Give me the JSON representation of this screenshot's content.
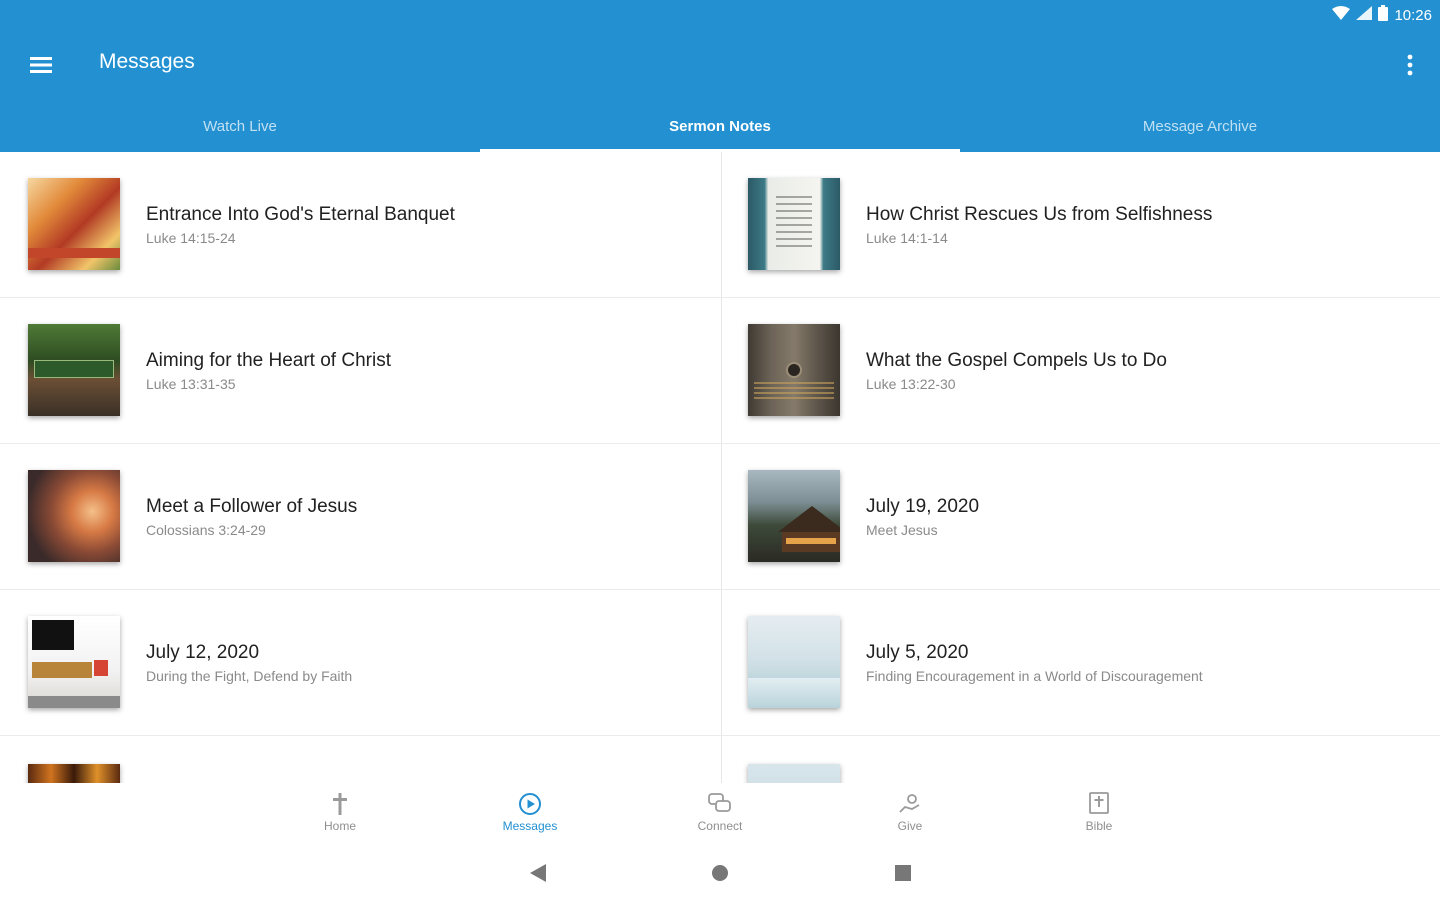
{
  "status_bar": {
    "time": "10:26"
  },
  "app_bar": {
    "title": "Messages"
  },
  "tabs": [
    {
      "label": "Watch Live",
      "active": false
    },
    {
      "label": "Sermon Notes",
      "active": true
    },
    {
      "label": "Message Archive",
      "active": false
    }
  ],
  "messages": [
    {
      "title": "Entrance Into God's Eternal Banquet",
      "subtitle": "Luke 14:15-24"
    },
    {
      "title": "How Christ Rescues Us from Selfishness",
      "subtitle": "Luke 14:1-14"
    },
    {
      "title": "Aiming for the Heart of Christ",
      "subtitle": "Luke 13:31-35"
    },
    {
      "title": "What the Gospel Compels Us to Do",
      "subtitle": "Luke 13:22-30"
    },
    {
      "title": "Meet a Follower of Jesus",
      "subtitle": "Colossians 3:24-29"
    },
    {
      "title": "July 19, 2020",
      "subtitle": "Meet Jesus"
    },
    {
      "title": "July 12, 2020",
      "subtitle": "During the Fight, Defend by Faith"
    },
    {
      "title": "July 5, 2020",
      "subtitle": "Finding Encouragement in a World of Discouragement"
    }
  ],
  "bottom_nav": [
    {
      "label": "Home",
      "icon": "cross-icon",
      "active": false
    },
    {
      "label": "Messages",
      "icon": "play-circle-icon",
      "active": true
    },
    {
      "label": "Connect",
      "icon": "chat-bubbles-icon",
      "active": false
    },
    {
      "label": "Give",
      "icon": "give-hand-icon",
      "active": false
    },
    {
      "label": "Bible",
      "icon": "bible-icon",
      "active": false
    }
  ],
  "colors": {
    "primary": "#2290d1",
    "active_nav": "#2290d1",
    "inactive_nav": "#8f8f8f"
  }
}
